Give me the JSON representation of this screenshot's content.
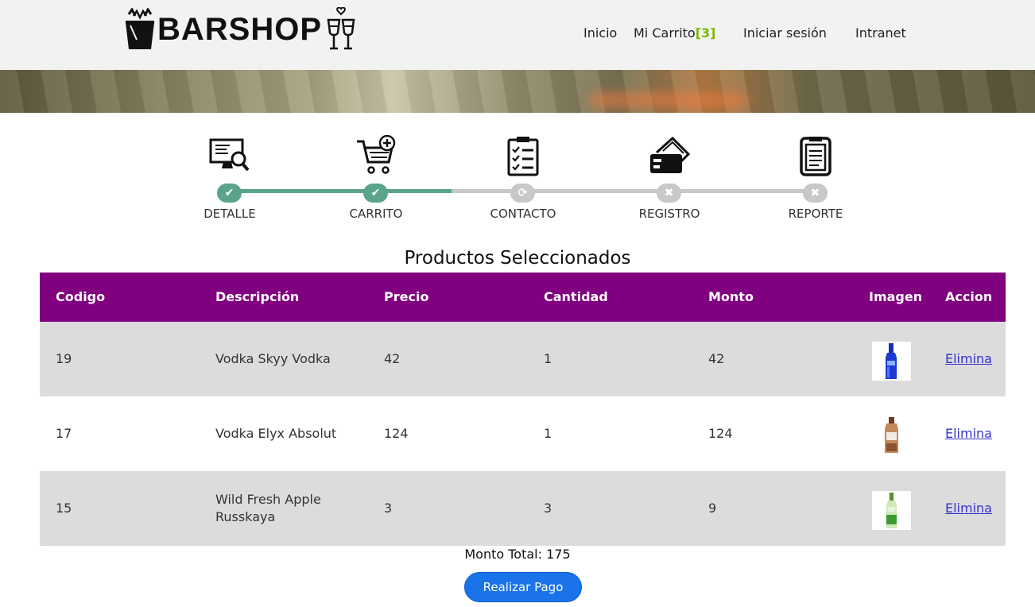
{
  "header": {
    "brand": "BARSHOP",
    "nav": {
      "home": "Inicio",
      "cart": "Mi Carrito",
      "cart_count": "[3]",
      "login": "Iniciar sesión",
      "intranet": "Intranet"
    }
  },
  "steps": [
    {
      "label": "DETALLE",
      "icon": "monitor-search-icon",
      "state": "done"
    },
    {
      "label": "CARRITO",
      "icon": "cart-add-icon",
      "state": "done"
    },
    {
      "label": "CONTACTO",
      "icon": "checklist-icon",
      "state": "current"
    },
    {
      "label": "REGISTRO",
      "icon": "card-icon",
      "state": "pending"
    },
    {
      "label": "REPORTE",
      "icon": "clipboard-icon",
      "state": "pending"
    }
  ],
  "colors": {
    "step_done": "#5aa58a",
    "step_pending": "#c8c8c8",
    "table_header": "#800080",
    "row_alt": "#dcdcdc",
    "cart_count": "#7ab800",
    "pay_button": "#1a73e8"
  },
  "main": {
    "title": "Productos Seleccionados",
    "columns": [
      "Codigo",
      "Descripción",
      "Precio",
      "Cantidad",
      "Monto",
      "Imagen",
      "Accion"
    ],
    "rows": [
      {
        "code": "19",
        "desc": "Vodka Skyy Vodka",
        "desc2": "",
        "price": "42",
        "qty": "1",
        "amount": "42",
        "image": "blue-bottle",
        "action": "Elimina"
      },
      {
        "code": "17",
        "desc": "Vodka Elyx Absolut",
        "desc2": "",
        "price": "124",
        "qty": "1",
        "amount": "124",
        "image": "copper-bottle",
        "action": "Elimina"
      },
      {
        "code": "15",
        "desc": "Wild Fresh Apple",
        "desc2": "Russkaya",
        "price": "3",
        "qty": "3",
        "amount": "9",
        "image": "green-bottle",
        "action": "Elimina"
      }
    ],
    "total": "Monto Total: 175",
    "pay_button": "Realizar Pago"
  }
}
